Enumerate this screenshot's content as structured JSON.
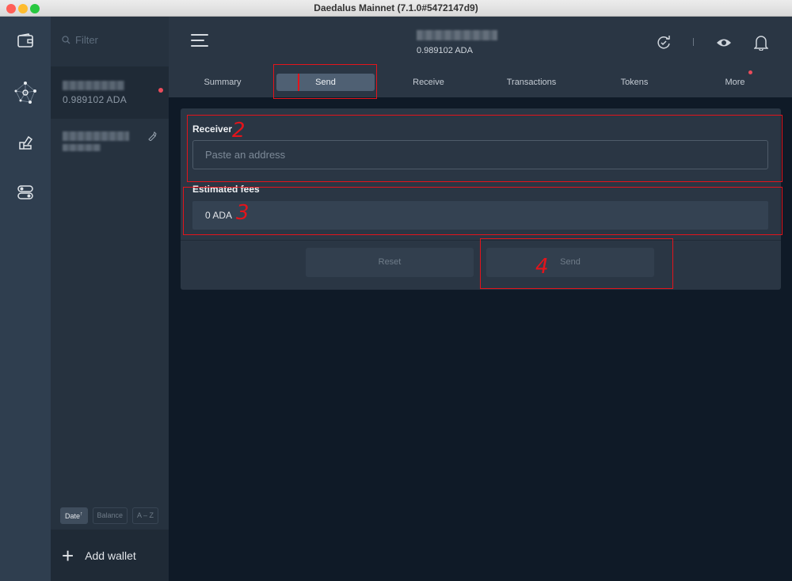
{
  "window": {
    "title": "Daedalus Mainnet (7.1.0#5472147d9)"
  },
  "rail": {
    "icons": [
      "wallet-icon",
      "staking-network-icon",
      "voting-icon",
      "settings-toggle-icon"
    ]
  },
  "wallet_list": {
    "filter_placeholder": "Filter",
    "wallets": [
      {
        "balance": "0.989102 ADA",
        "has_notification": true
      },
      {
        "balance": "",
        "hardware": true
      }
    ],
    "sort": [
      {
        "label": "Date",
        "active": true,
        "indicator": "↑"
      },
      {
        "label": "Balance",
        "active": false
      },
      {
        "label": "A – Z",
        "active": false
      }
    ],
    "add_wallet_label": "Add wallet"
  },
  "header": {
    "wallet_balance": "0.989102 ADA",
    "icons": [
      "menu-icon",
      "sync-icon",
      "eye-icon",
      "bell-icon"
    ]
  },
  "tabs": [
    {
      "label": "Summary",
      "active": false
    },
    {
      "label": "Send",
      "active": true
    },
    {
      "label": "Receive",
      "active": false
    },
    {
      "label": "Transactions",
      "active": false
    },
    {
      "label": "Tokens",
      "active": false
    },
    {
      "label": "More",
      "active": false,
      "badge": true
    }
  ],
  "send_form": {
    "receiver_label": "Receiver",
    "receiver_placeholder": "Paste an address",
    "fees_label": "Estimated fees",
    "fees_value": "0 ADA",
    "reset_label": "Reset",
    "send_label": "Send"
  },
  "annotations": {
    "color": "#e3141b",
    "numbers": [
      "2",
      "3",
      "4"
    ]
  },
  "colors": {
    "accent_red": "#ea4c5b",
    "panel": "#2a3644",
    "background": "#0f1a27"
  }
}
